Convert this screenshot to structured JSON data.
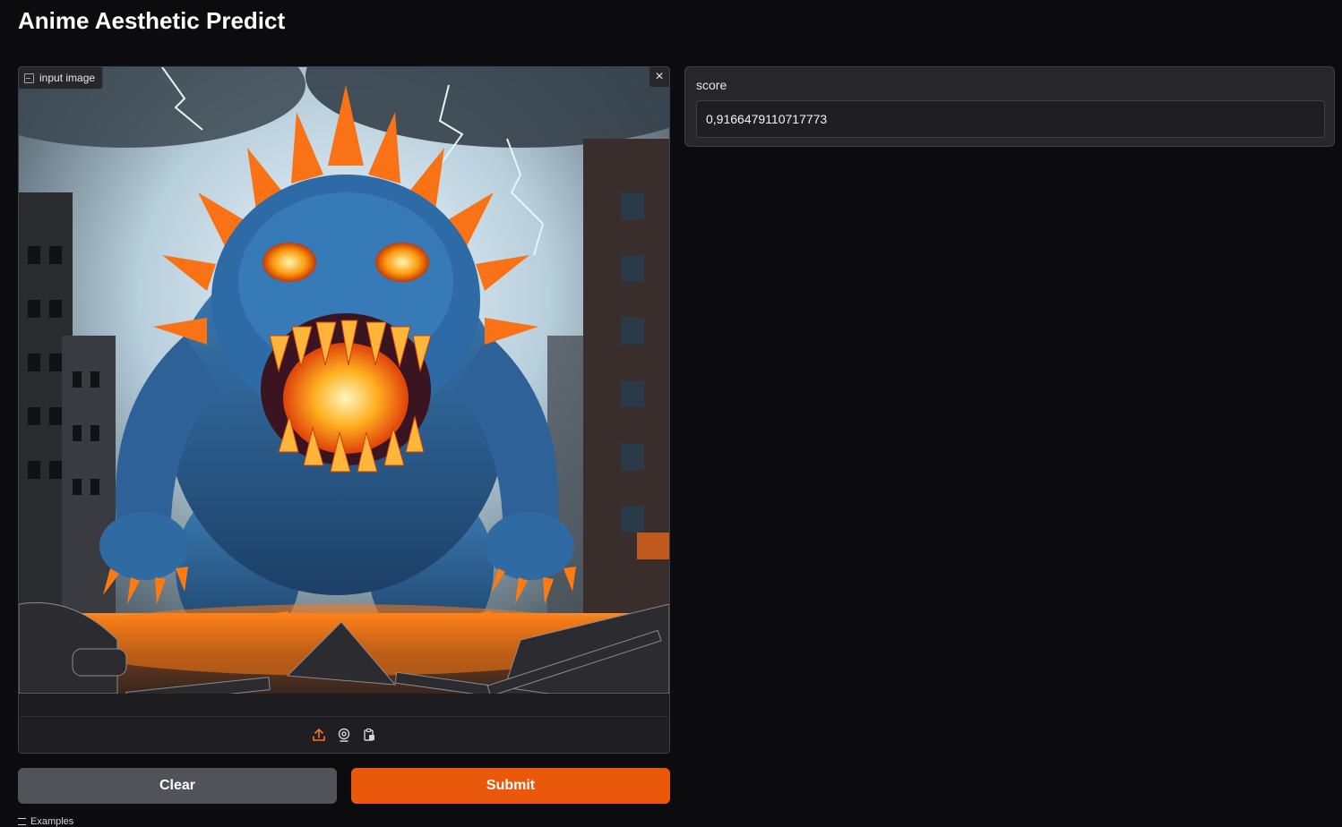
{
  "app": {
    "title": "Anime Aesthetic Predict"
  },
  "input_image": {
    "label": "input image",
    "close_symbol": "×",
    "toolbar_icons": [
      "upload-icon",
      "webcam-icon",
      "clipboard-paste-icon"
    ]
  },
  "buttons": {
    "clear_label": "Clear",
    "submit_label": "Submit"
  },
  "output": {
    "label": "score",
    "value": "0,9166479110717773"
  },
  "examples": {
    "label": "Examples"
  },
  "colors": {
    "background": "#0c0c0f",
    "panel": "#27272a",
    "accent": "#ea580c",
    "secondary_button": "#52525b"
  }
}
